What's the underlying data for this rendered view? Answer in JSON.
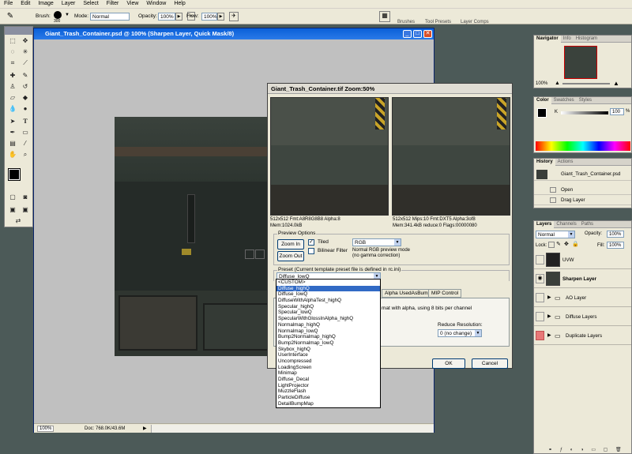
{
  "menubar": [
    "File",
    "Edit",
    "Image",
    "Layer",
    "Select",
    "Filter",
    "View",
    "Window",
    "Help"
  ],
  "options": {
    "brush_label": "Brush:",
    "brush_size": "300",
    "mode_label": "Mode:",
    "mode_value": "Normal",
    "opacity_label": "Opacity:",
    "opacity_value": "100%",
    "flow_label": "Flow:",
    "flow_value": "100%",
    "well_tabs": [
      "Brushes",
      "Tool Presets",
      "Layer Comps"
    ]
  },
  "document": {
    "title": "Giant_Trash_Container.psd @ 100% (Sharpen Layer, Quick Mask/8)",
    "zoom": "100%",
    "doc_info": "Doc: 768.0K/43.6M"
  },
  "dialog": {
    "title": "Giant_Trash_Container.tif  Zoom:50%",
    "left_info": [
      "512x512 Fmt:A8R8G8B8 Alpha:8",
      "Mem:1024.0kB"
    ],
    "right_info": [
      "512x512 Mips:10 Fmt:DXT5 Alpha:3of8",
      "Mem:341.4kB reduce:0 Flags:00000080"
    ],
    "preview_options_label": "Preview Options",
    "zoom_in": "Zoom In",
    "zoom_out": "Zoom Out",
    "tiled_label": "Tiled",
    "bilinear_label": "Bilinear Filter",
    "channel_value": "RGB",
    "channel_desc": [
      "Normal RGB preview mode",
      "(no gamma correction)"
    ],
    "preset_label": "Preset (Current template preset file is defined in rc.ini)",
    "preset_value": "Diffuse_lowQ",
    "tabs": [
      "Alpha UsedAsBump",
      "MIP Control"
    ],
    "body_text": "mat with alpha, using 8 bits per channel",
    "reduce_label": "Reduce Resolution:",
    "reduce_value": "0 (no change)",
    "ok": "OK",
    "cancel": "Cancel"
  },
  "preset_options": [
    "<CUSTOM>",
    "Diffuse_highQ",
    "Diffuse_lowQ",
    "DiffuseWithAlphaTest_highQ",
    "Specular_highQ",
    "Specular_lowQ",
    "SpecularWithGlossInAlpha_highQ",
    "Normalmap_highQ",
    "Normalmap_lowQ",
    "Bump2Normalmap_highQ",
    "Bump2Normalmap_lowQ",
    "Skybox_highQ",
    "UserInterface",
    "Uncompressed",
    "LoadingScreen",
    "Minimap",
    "Diffuse_Decal",
    "LightProjector",
    "MuzzleFlash",
    "ParticleDiffuse",
    "DetailBumpMap"
  ],
  "preset_highlighted": "Diffuse_highQ",
  "navigator": {
    "tabs": [
      "Navigator",
      "Info",
      "Histogram"
    ],
    "zoom": "100%"
  },
  "color": {
    "tabs": [
      "Color",
      "Swatches",
      "Styles"
    ],
    "channel": "K",
    "value": "100",
    "unit": "%"
  },
  "history": {
    "tabs": [
      "History",
      "Actions"
    ],
    "snapshot": "Giant_Trash_Container.psd",
    "items": [
      "Open",
      "Drag Layer"
    ]
  },
  "layers": {
    "tabs": [
      "Layers",
      "Channels",
      "Paths"
    ],
    "blend": "Normal",
    "opacity_label": "Opacity:",
    "opacity": "100%",
    "lock_label": "Lock:",
    "fill_label": "Fill:",
    "fill": "100%",
    "rows": [
      {
        "name": "UVW",
        "type": "layer"
      },
      {
        "name": "Sharpen Layer",
        "type": "layer",
        "active": true
      },
      {
        "name": "AO Layer",
        "type": "group"
      },
      {
        "name": "Diffuse Layers",
        "type": "group"
      },
      {
        "name": "Duplicate Layers",
        "type": "group"
      }
    ]
  }
}
